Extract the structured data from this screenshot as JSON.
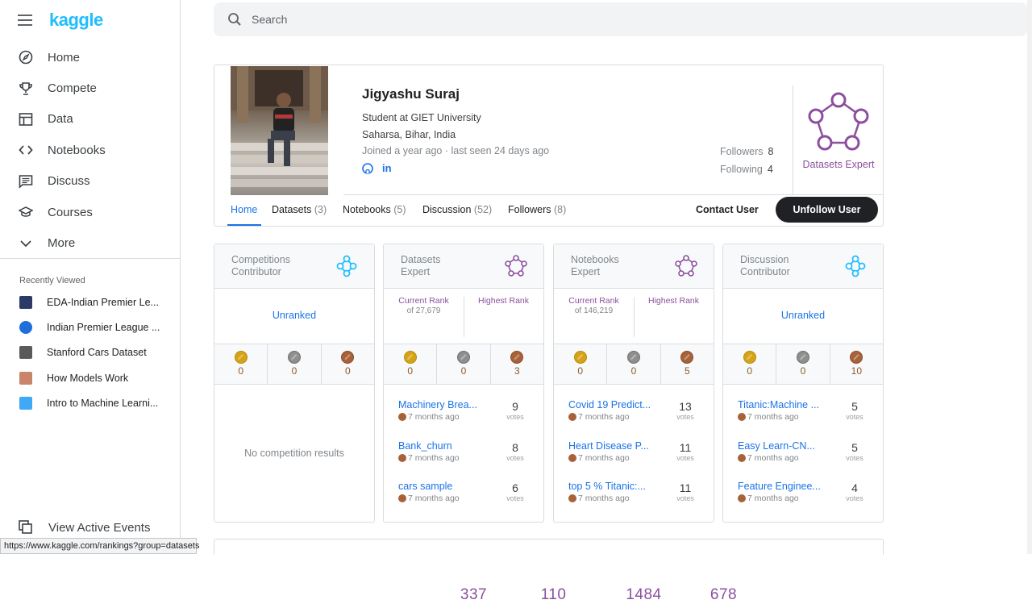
{
  "app": {
    "name": "kaggle"
  },
  "search": {
    "placeholder": "Search"
  },
  "nav": [
    {
      "label": "Home",
      "icon": "compass-icon"
    },
    {
      "label": "Compete",
      "icon": "trophy-icon"
    },
    {
      "label": "Data",
      "icon": "table-icon"
    },
    {
      "label": "Notebooks",
      "icon": "code-icon"
    },
    {
      "label": "Discuss",
      "icon": "comment-icon"
    },
    {
      "label": "Courses",
      "icon": "graduation-cap-icon"
    },
    {
      "label": "More",
      "icon": "chevron-down-icon"
    }
  ],
  "recently_viewed": {
    "title": "Recently Viewed",
    "items": [
      {
        "label": "EDA-Indian Premier Le...",
        "color": "#2b3a67"
      },
      {
        "label": "Indian Premier League ...",
        "color": "#1e6fd9"
      },
      {
        "label": "Stanford Cars Dataset",
        "color": "#5a5a5a"
      },
      {
        "label": "How Models Work",
        "color": "#c8856a"
      },
      {
        "label": "Intro to Machine Learni...",
        "color": "#3fa9f5"
      }
    ]
  },
  "footer": {
    "view_events": "View Active Events"
  },
  "status_url": "https://www.kaggle.com/rankings?group=datasets",
  "profile": {
    "name": "Jigyashu Suraj",
    "occupation": "Student at GIET University",
    "location": "Saharsa, Bihar, India",
    "joined": "Joined a year ago · last seen 24 days ago",
    "followers_label": "Followers",
    "followers": "8",
    "following_label": "Following",
    "following": "4",
    "tier": "Datasets Expert",
    "tier_color": "#8c4f9e"
  },
  "tabs": [
    {
      "label": "Home",
      "count": ""
    },
    {
      "label": "Datasets",
      "count": "(3)"
    },
    {
      "label": "Notebooks",
      "count": "(5)"
    },
    {
      "label": "Discussion",
      "count": "(52)"
    },
    {
      "label": "Followers",
      "count": "(8)"
    }
  ],
  "actions": {
    "contact": "Contact User",
    "unfollow": "Unfollow User"
  },
  "cards": [
    {
      "title": "Competitions\nContributor",
      "tier": "contributor",
      "unranked": "Unranked",
      "medals": {
        "gold": "0",
        "silver": "0",
        "bronze": "0"
      },
      "empty_text": "No competition results"
    },
    {
      "title": "Datasets\nExpert",
      "tier": "expert",
      "current_rank_label": "Current Rank",
      "current_rank": "337",
      "of_total": "of 27,679",
      "highest_rank_label": "Highest Rank",
      "highest_rank": "110",
      "medals": {
        "gold": "0",
        "silver": "0",
        "bronze": "3"
      },
      "entries": [
        {
          "title": "Machinery Brea...",
          "time": "7 months ago",
          "votes": "9",
          "votes_label": "votes"
        },
        {
          "title": "Bank_churn",
          "time": "7 months ago",
          "votes": "8",
          "votes_label": "votes"
        },
        {
          "title": "cars sample",
          "time": "7 months ago",
          "votes": "6",
          "votes_label": "votes"
        }
      ]
    },
    {
      "title": "Notebooks\nExpert",
      "tier": "expert",
      "current_rank_label": "Current Rank",
      "current_rank": "1484",
      "of_total": "of 146,219",
      "highest_rank_label": "Highest Rank",
      "highest_rank": "678",
      "medals": {
        "gold": "0",
        "silver": "0",
        "bronze": "5"
      },
      "entries": [
        {
          "title": "Covid 19 Predict...",
          "time": "7 months ago",
          "votes": "13",
          "votes_label": "votes"
        },
        {
          "title": "Heart Disease P...",
          "time": "7 months ago",
          "votes": "11",
          "votes_label": "votes"
        },
        {
          "title": "top 5 % Titanic:...",
          "time": "7 months ago",
          "votes": "11",
          "votes_label": "votes"
        }
      ]
    },
    {
      "title": "Discussion\nContributor",
      "tier": "contributor",
      "unranked": "Unranked",
      "medals": {
        "gold": "0",
        "silver": "0",
        "bronze": "10"
      },
      "entries": [
        {
          "title": "Titanic:Machine ...",
          "time": "7 months ago",
          "votes": "5",
          "votes_label": "votes"
        },
        {
          "title": "Easy Learn-CN...",
          "time": "7 months ago",
          "votes": "5",
          "votes_label": "votes"
        },
        {
          "title": "Feature Enginee...",
          "time": "7 months ago",
          "votes": "4",
          "votes_label": "votes"
        }
      ]
    }
  ]
}
